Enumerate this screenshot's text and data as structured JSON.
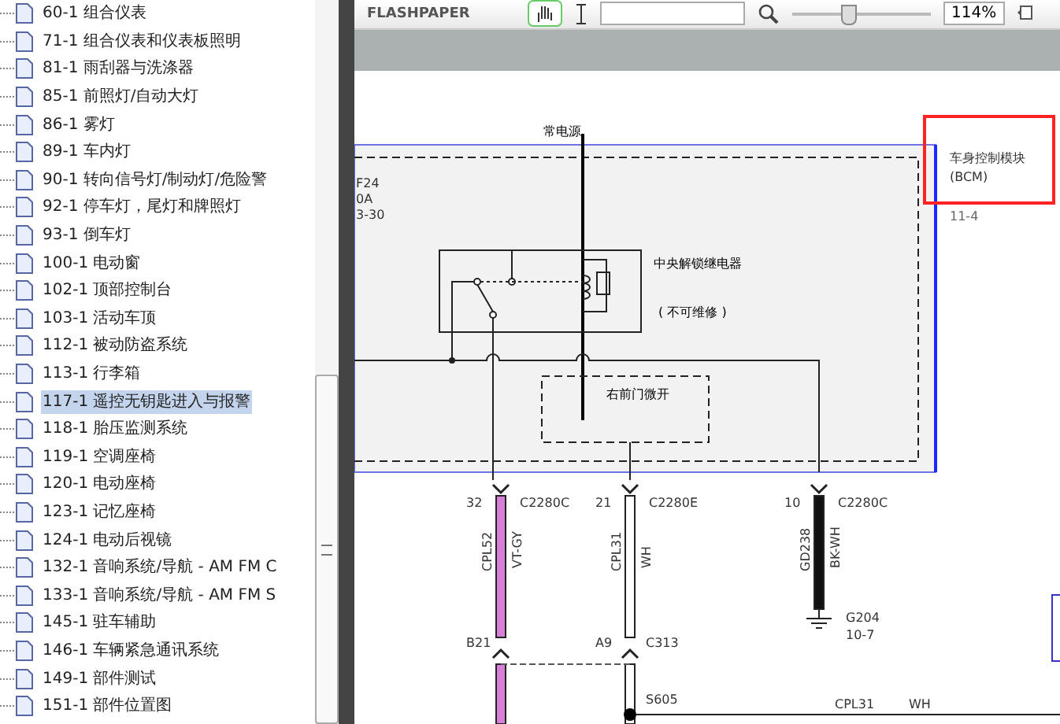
{
  "sidebar": {
    "items": [
      {
        "label": "60-1 组合仪表",
        "selected": false
      },
      {
        "label": "71-1 组合仪表和仪表板照明",
        "selected": false
      },
      {
        "label": "81-1 雨刮器与洗涤器",
        "selected": false
      },
      {
        "label": "85-1 前照灯/自动大灯",
        "selected": false
      },
      {
        "label": "86-1 雾灯",
        "selected": false
      },
      {
        "label": "89-1 车内灯",
        "selected": false
      },
      {
        "label": "90-1 转向信号灯/制动灯/危险警",
        "selected": false
      },
      {
        "label": "92-1 停车灯，尾灯和牌照灯",
        "selected": false
      },
      {
        "label": "93-1 倒车灯",
        "selected": false
      },
      {
        "label": "100-1 电动窗",
        "selected": false
      },
      {
        "label": "102-1 顶部控制台",
        "selected": false
      },
      {
        "label": "103-1 活动车顶",
        "selected": false
      },
      {
        "label": "112-1 被动防盗系统",
        "selected": false
      },
      {
        "label": "113-1 行李箱",
        "selected": false
      },
      {
        "label": "117-1 遥控无钥匙进入与报警",
        "selected": true
      },
      {
        "label": "118-1 胎压监测系统",
        "selected": false
      },
      {
        "label": "119-1 空调座椅",
        "selected": false
      },
      {
        "label": "120-1 电动座椅",
        "selected": false
      },
      {
        "label": "123-1 记忆座椅",
        "selected": false
      },
      {
        "label": "124-1 电动后视镜",
        "selected": false
      },
      {
        "label": "132-1 音响系统/导航 - AM FM C",
        "selected": false
      },
      {
        "label": "133-1 音响系统/导航 - AM FM S",
        "selected": false
      },
      {
        "label": "145-1 驻车辅助",
        "selected": false
      },
      {
        "label": "146-1 车辆紧急通讯系统",
        "selected": false
      },
      {
        "label": "149-1 部件测试",
        "selected": false
      },
      {
        "label": "151-1 部件位置图",
        "selected": false
      }
    ]
  },
  "toolbar": {
    "logo": "FLASHPAPER",
    "zoom_slider": {
      "level": 0.4
    },
    "zoom_value": "114%"
  },
  "diagram": {
    "power_label": "常电源",
    "fuse_labels": [
      "F24",
      "0A",
      "3-30"
    ],
    "relay_name": "中央解锁继电器",
    "relay_note": "( 不可维修 )",
    "switch_label": "右前门微开",
    "module_name": "车身控制模块",
    "module_abbr": "(BCM)",
    "module_ref": "11-4",
    "wires": [
      {
        "kind": "pink",
        "pin": "32",
        "connector": "C2280C",
        "circuit": "CPL52",
        "color_code": "VT-GY",
        "lower_pin": "B21"
      },
      {
        "kind": "white",
        "pin": "21",
        "connector": "C2280E",
        "circuit": "CPL31",
        "color_code": "WH",
        "lower_pin": "A9",
        "lower_connector": "C313"
      },
      {
        "kind": "black",
        "pin": "10",
        "connector": "C2280C",
        "circuit": "GD238",
        "color_code": "BK-WH",
        "ground": "G204",
        "ground_ref": "10-7"
      }
    ],
    "splice": "S605",
    "branch_circuit": "CPL31",
    "branch_color": "WH"
  }
}
